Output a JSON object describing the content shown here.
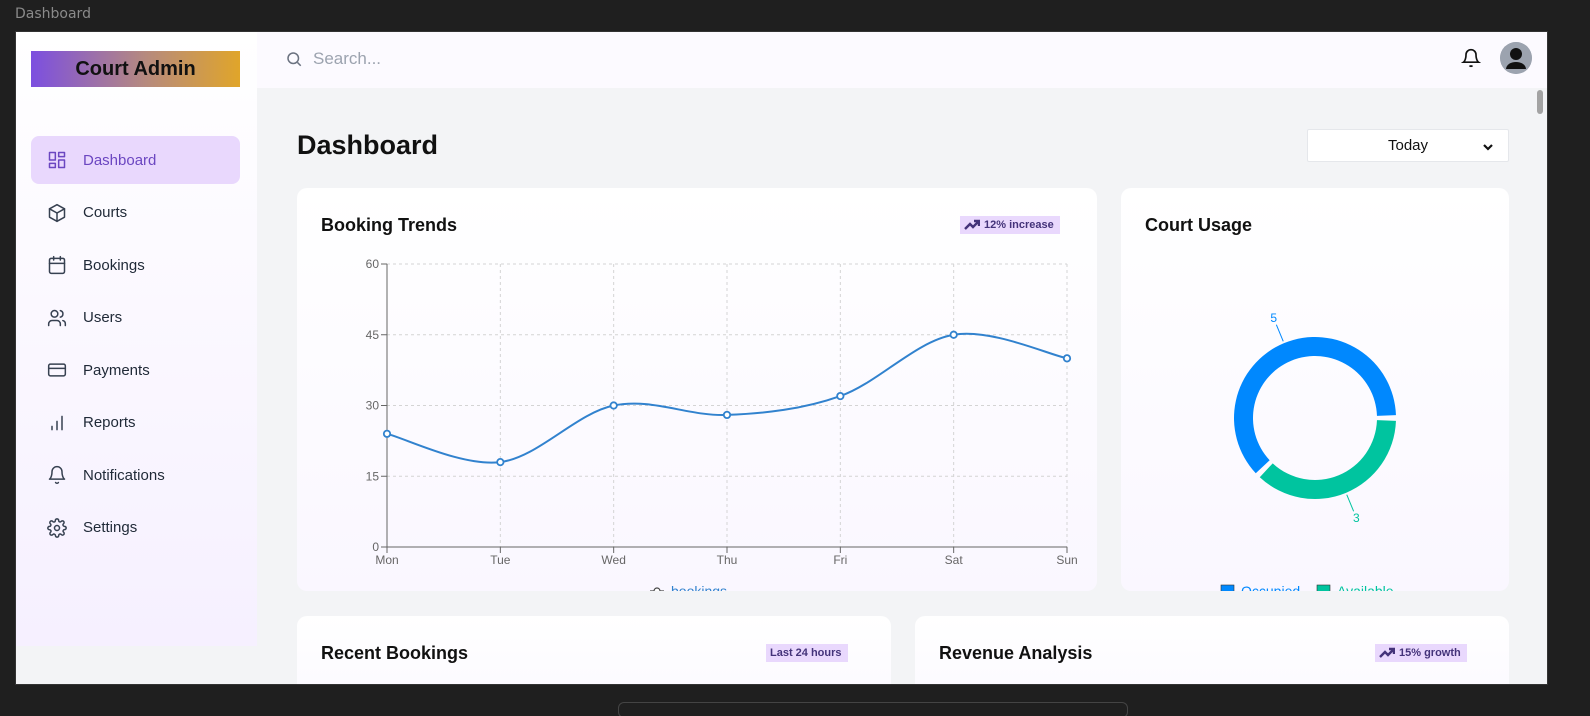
{
  "window_title": "Dashboard",
  "sidebar": {
    "logo": "Court Admin",
    "items": [
      {
        "label": "Dashboard",
        "icon": "dashboard-icon",
        "active": true
      },
      {
        "label": "Courts",
        "icon": "box-icon",
        "active": false
      },
      {
        "label": "Bookings",
        "icon": "calendar-icon",
        "active": false
      },
      {
        "label": "Users",
        "icon": "users-icon",
        "active": false
      },
      {
        "label": "Payments",
        "icon": "credit-card-icon",
        "active": false
      },
      {
        "label": "Reports",
        "icon": "bar-chart-icon",
        "active": false
      },
      {
        "label": "Notifications",
        "icon": "bell-icon",
        "active": false
      },
      {
        "label": "Settings",
        "icon": "gear-icon",
        "active": false
      }
    ]
  },
  "header": {
    "search_placeholder": "Search...",
    "notification_icon": "bell-icon",
    "avatar_icon": "user-avatar-icon"
  },
  "main": {
    "title": "Dashboard",
    "period_select": "Today",
    "booking_trends": {
      "title": "Booking Trends",
      "badge": "12% increase",
      "legend": "bookings"
    },
    "court_usage": {
      "title": "Court Usage"
    },
    "recent_bookings": {
      "title": "Recent Bookings",
      "badge": "Last 24 hours"
    },
    "revenue_analysis": {
      "title": "Revenue Analysis",
      "badge": "15% growth"
    }
  },
  "colors": {
    "accent": "#6b46c1",
    "accent_light": "#e9d8fd",
    "line": "#3182ce",
    "occupied": "#0088fe",
    "available": "#00c49f"
  },
  "chart_data": [
    {
      "type": "line",
      "title": "Booking Trends",
      "categories": [
        "Mon",
        "Tue",
        "Wed",
        "Thu",
        "Fri",
        "Sat",
        "Sun"
      ],
      "series": [
        {
          "name": "bookings",
          "values": [
            24,
            18,
            30,
            28,
            32,
            45,
            40
          ]
        }
      ],
      "yticks": [
        "0",
        "15",
        "30",
        "45",
        "60"
      ],
      "ylim": [
        0,
        60
      ],
      "grid": true,
      "legend": "bottom"
    },
    {
      "type": "pie",
      "title": "Court Usage",
      "donut": true,
      "categories": [
        "Occupied",
        "Available"
      ],
      "values": [
        5,
        3
      ],
      "labels": [
        "5",
        "3"
      ],
      "legend": "bottom"
    }
  ]
}
